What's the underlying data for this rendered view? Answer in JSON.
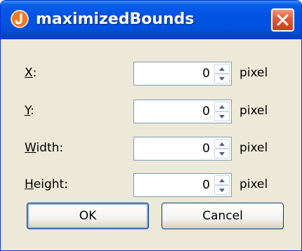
{
  "dialog": {
    "title": "maximizedBounds",
    "fields": [
      {
        "mnemonic": "X",
        "rest": ":",
        "value": "0",
        "unit": "pixel"
      },
      {
        "mnemonic": "Y",
        "rest": ":",
        "value": "0",
        "unit": "pixel"
      },
      {
        "mnemonic": "W",
        "rest": "idth:",
        "value": "0",
        "unit": "pixel"
      },
      {
        "mnemonic": "H",
        "rest": "eight:",
        "value": "0",
        "unit": "pixel"
      }
    ],
    "ok_label": "OK",
    "cancel_label": "Cancel"
  },
  "colors": {
    "titlebar": "#0054e3",
    "close_button": "#e25c3a",
    "app_icon": "#f47a20",
    "dialog_bg": "#ece9d8"
  },
  "icons": {
    "app": "java-cup-icon",
    "close": "close-icon",
    "spin_up": "spin-up-arrow-icon",
    "spin_down": "spin-down-arrow-icon"
  }
}
